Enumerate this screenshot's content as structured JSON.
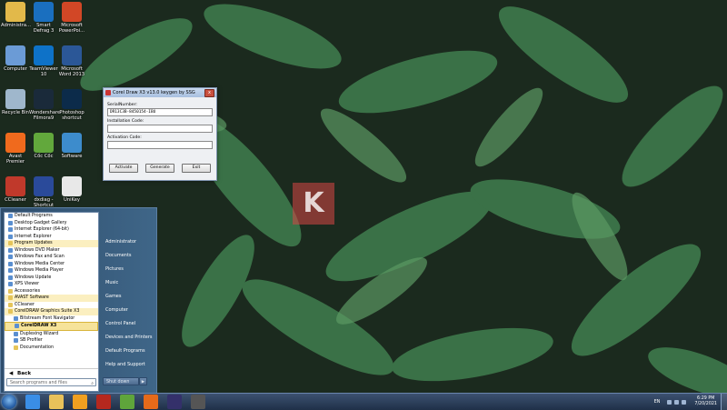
{
  "colors": {
    "accent": "#2f4e6d",
    "highlight": "#fbefc0",
    "selection": "#f6e39a",
    "taskbar": "#1f3048"
  },
  "desktop": {
    "icons": [
      {
        "label": "Administra...",
        "icon": "folder-icon",
        "color": "#e2b94a"
      },
      {
        "label": "Smart Defrag 3",
        "icon": "defrag-icon",
        "color": "#1a6fbf"
      },
      {
        "label": "Microsoft PowerPoi...",
        "icon": "powerpoint-icon",
        "color": "#d24726"
      },
      {
        "label": "Computer",
        "icon": "computer-icon",
        "color": "#6b9bd6"
      },
      {
        "label": "TeamViewer 10",
        "icon": "teamviewer-icon",
        "color": "#0e72c8"
      },
      {
        "label": "Microsoft Word 2013",
        "icon": "word-icon",
        "color": "#2b5797"
      },
      {
        "label": "Recycle Bin",
        "icon": "recycle-bin-icon",
        "color": "#9fb7cc"
      },
      {
        "label": "Wondershare Filmora9",
        "icon": "filmora-icon",
        "color": "#1a2a3a"
      },
      {
        "label": "Photoshop shortcut",
        "icon": "photoshop-icon",
        "color": "#0c2b4a"
      },
      {
        "label": "Avast Premier",
        "icon": "avast-icon",
        "color": "#f06a1d"
      },
      {
        "label": "Cốc Cốc",
        "icon": "coccoc-icon",
        "color": "#62a83c"
      },
      {
        "label": "Software",
        "icon": "software-icon",
        "color": "#3d8ccc"
      },
      {
        "label": "CCleaner",
        "icon": "ccleaner-icon",
        "color": "#c0392b"
      },
      {
        "label": "dxdiag - Shortcut",
        "icon": "dxdiag-icon",
        "color": "#2a4a9a"
      },
      {
        "label": "UniKey",
        "icon": "unikey-icon",
        "color": "#e8e8e8"
      }
    ]
  },
  "dialog": {
    "title": "Corel Draw X3 v13.0 keygen by SSG",
    "close_label": "x",
    "serial_label": "SerialNumber:",
    "serial_value": "DR13C3B-8450154-IBU",
    "install_label": "Installation Code:",
    "install_value": "",
    "activation_label": "Activation Code:",
    "activation_value": "",
    "buttons": {
      "activate": "Activate",
      "generate": "Generate",
      "exit": "Exit"
    }
  },
  "watermark": {
    "letter": "K"
  },
  "startmenu": {
    "programs": [
      {
        "label": "Default Programs",
        "kind": "app",
        "state": ""
      },
      {
        "label": "Desktop Gadget Gallery",
        "kind": "app",
        "state": ""
      },
      {
        "label": "Internet Explorer (64-bit)",
        "kind": "app",
        "state": ""
      },
      {
        "label": "Internet Explorer",
        "kind": "app",
        "state": ""
      },
      {
        "label": "Program Updates",
        "kind": "folder",
        "state": "hl"
      },
      {
        "label": "Windows DVD Maker",
        "kind": "app",
        "state": ""
      },
      {
        "label": "Windows Fax and Scan",
        "kind": "app",
        "state": ""
      },
      {
        "label": "Windows Media Center",
        "kind": "app",
        "state": ""
      },
      {
        "label": "Windows Media Player",
        "kind": "app",
        "state": ""
      },
      {
        "label": "Windows Update",
        "kind": "app",
        "state": ""
      },
      {
        "label": "XPS Viewer",
        "kind": "app",
        "state": ""
      },
      {
        "label": "Accessories",
        "kind": "folder",
        "state": ""
      },
      {
        "label": "AVAST Software",
        "kind": "folder",
        "state": "hl"
      },
      {
        "label": "CCleaner",
        "kind": "folder",
        "state": ""
      },
      {
        "label": "CorelDRAW Graphics Suite X3",
        "kind": "folder",
        "state": "hl"
      },
      {
        "label": "Bitstream Font Navigator",
        "kind": "app",
        "state": "sub"
      },
      {
        "label": "CorelDRAW X3",
        "kind": "app",
        "state": "sel"
      },
      {
        "label": "Duplexing Wizard",
        "kind": "app",
        "state": "sub"
      },
      {
        "label": "SB Profiler",
        "kind": "app",
        "state": "sub"
      },
      {
        "label": "Documentation",
        "kind": "folder",
        "state": "sub"
      }
    ],
    "back_label": "Back",
    "search_placeholder": "Search programs and files",
    "right_items": [
      "Administrator",
      "Documents",
      "Pictures",
      "Music",
      "Games",
      "Computer",
      "Control Panel",
      "Devices and Printers",
      "Default Programs",
      "Help and Support"
    ],
    "shutdown_label": "Shut down"
  },
  "taskbar": {
    "pinned": [
      {
        "icon": "internet-explorer-icon",
        "color": "#3a8ee6"
      },
      {
        "icon": "explorer-icon",
        "color": "#e8c15a"
      },
      {
        "icon": "media-player-icon",
        "color": "#f0a020"
      },
      {
        "icon": "app-red-icon",
        "color": "#b5281e"
      },
      {
        "icon": "coccoc-icon",
        "color": "#5fa53b"
      },
      {
        "icon": "app-orange-icon",
        "color": "#e66a1a"
      },
      {
        "icon": "app-dark-icon",
        "color": "#34306a"
      },
      {
        "icon": "keygen-icon",
        "color": "#555555"
      }
    ],
    "lang": "EN",
    "time": "6:29 PM",
    "date": "7/20/2021"
  }
}
